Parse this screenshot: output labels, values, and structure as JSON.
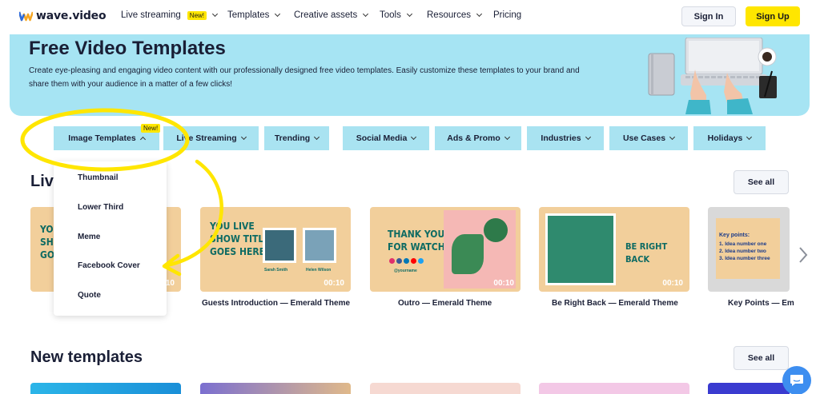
{
  "brand": {
    "name": "wave.video"
  },
  "nav": {
    "items": [
      {
        "label": "Live streaming",
        "badge": "New!",
        "has_dropdown": true
      },
      {
        "label": "Templates",
        "has_dropdown": true
      },
      {
        "label": "Creative assets",
        "has_dropdown": true
      },
      {
        "label": "Tools",
        "has_dropdown": true
      },
      {
        "label": "Resources",
        "has_dropdown": true
      },
      {
        "label": "Pricing",
        "has_dropdown": false
      }
    ],
    "signin_label": "Sign In",
    "signup_label": "Sign Up"
  },
  "hero": {
    "title": "Free Video Templates",
    "description": "Create eye-pleasing and engaging video content with our professionally designed free video templates. Easily customize these templates to your brand and share them with your audience in a matter of a few clicks!"
  },
  "categories": {
    "items": [
      {
        "label": "Image Templates",
        "state": "open"
      },
      {
        "label": "Live Streaming"
      },
      {
        "label": "Trending"
      },
      {
        "label": "Social Media"
      },
      {
        "label": "Ads & Promo"
      },
      {
        "label": "Industries"
      },
      {
        "label": "Use Cases"
      },
      {
        "label": "Holidays"
      }
    ],
    "new_badge": "New!"
  },
  "dropdown": {
    "items": [
      "Thumbnail",
      "Lower Third",
      "Meme",
      "Facebook Cover",
      "Quote"
    ]
  },
  "live_section": {
    "title_partial": "Live",
    "see_all": "See all",
    "cards": [
      {
        "caption": "",
        "duration": "00:10",
        "text": "YOU\nSHO\nGOES"
      },
      {
        "caption": "Guests Introduction — Emerald Theme",
        "duration": "00:10",
        "text": "YOU LIVE\nSHOW TITLE\nGOES HERE",
        "guest1": "Sarah Smith",
        "guest2": "Helen Wilson"
      },
      {
        "caption": "Outro — Emerald Theme",
        "duration": "00:10",
        "text": "THANK YOU\nFOR WATCHING",
        "handle": "@yourname"
      },
      {
        "caption": "Be Right Back — Emerald Theme",
        "duration": "00:10",
        "text": "BE RIGHT BACK"
      },
      {
        "caption": "Key Points — Em",
        "duration": "",
        "heading": "Key points:",
        "points": [
          "1. Idea number one",
          "2. Idea number two",
          "3. Idea number three"
        ]
      }
    ]
  },
  "new_section": {
    "title": "New templates",
    "see_all": "See all"
  },
  "colors": {
    "accent_yellow": "#ffe600",
    "hero_bg": "#a6e4f3",
    "category_bg": "#a9e3f1",
    "card_bg": "#f2cf9b",
    "emerald_text": "#0f6b63"
  }
}
